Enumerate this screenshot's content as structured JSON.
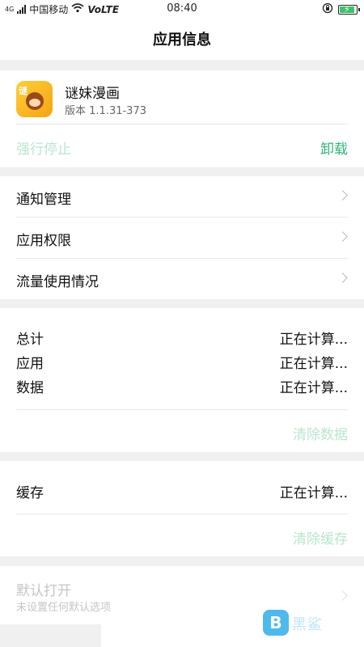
{
  "status_bar": {
    "carrier_signal_label": "4G",
    "carrier": "中国移动",
    "network": "VoLTE",
    "time": "08:40"
  },
  "nav": {
    "title": "应用信息"
  },
  "app": {
    "name": "谜妹漫画",
    "version": "版本 1.1.31-373",
    "icon_name": "app-icon-mimei-manhua",
    "icon_label": "谜",
    "force_stop_label": "强行停止",
    "uninstall_label": "卸载"
  },
  "menu": {
    "items": [
      {
        "label": "通知管理"
      },
      {
        "label": "应用权限"
      },
      {
        "label": "流量使用情况"
      }
    ]
  },
  "storage": {
    "rows": [
      {
        "label": "总计",
        "value": "正在计算..."
      },
      {
        "label": "应用",
        "value": "正在计算..."
      },
      {
        "label": "数据",
        "value": "正在计算..."
      }
    ],
    "clear_data_label": "清除数据"
  },
  "cache": {
    "label": "缓存",
    "value": "正在计算...",
    "clear_cache_label": "清除缓存"
  },
  "default_open": {
    "title": "默认打开",
    "subtitle": "未设置任何默认选项"
  },
  "watermark": {
    "logo": "B",
    "text": "黑鲨"
  },
  "colors": {
    "accent": "#2fb574",
    "accent_disabled": "#b9e6cf",
    "background": "#f0f0f0"
  }
}
